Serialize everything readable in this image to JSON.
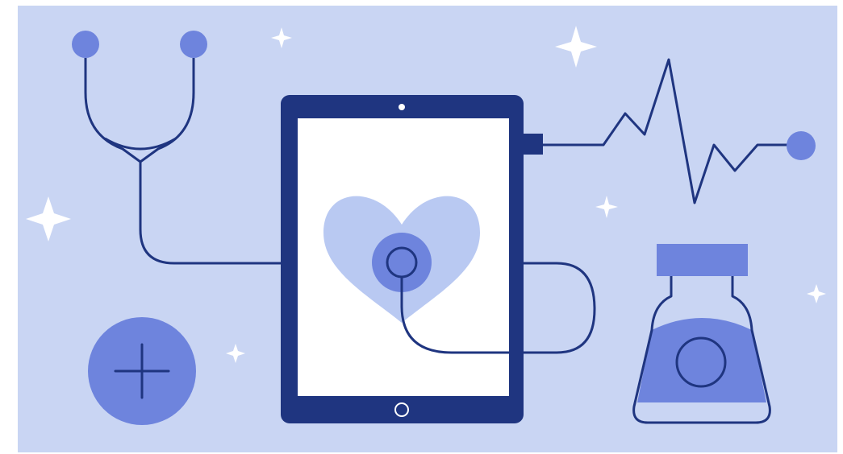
{
  "illustration": {
    "subject": "telemedicine-tablet",
    "icons": [
      "stethoscope-icon",
      "tablet-icon",
      "heart-icon",
      "heartbeat-line-icon",
      "medicine-bottle-icon",
      "plus-icon",
      "sparkle-icon"
    ]
  },
  "colors": {
    "background": "#c9d5f3",
    "navy": "#1f3580",
    "accent": "#6e84dd",
    "light_blue": "#b9c9f2",
    "screen": "#ffffff",
    "sparkle": "#ffffff"
  }
}
